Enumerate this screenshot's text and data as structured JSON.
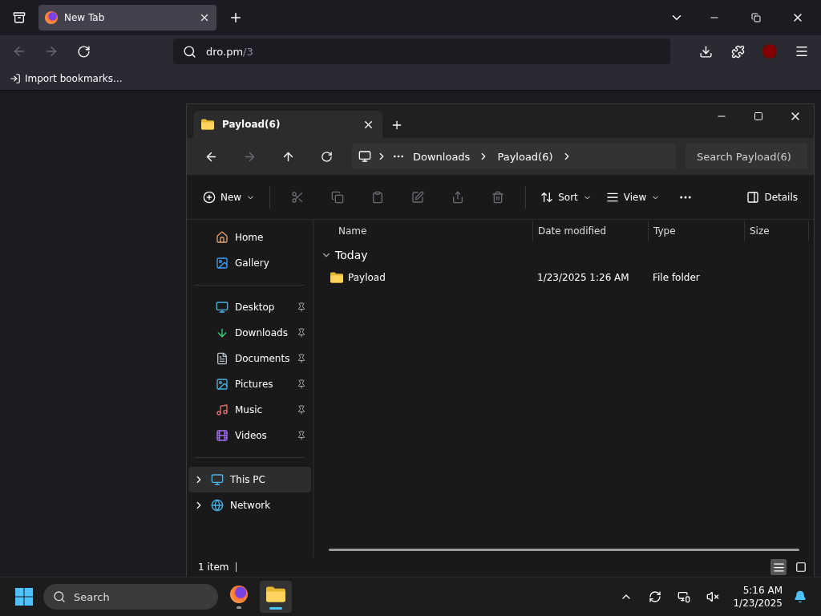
{
  "browser": {
    "tabs": [
      {
        "title": "New Tab",
        "selected": true
      }
    ],
    "address": {
      "host": "dro.pm",
      "path": "/3"
    },
    "bookmarks": [
      {
        "label": "Import bookmarks..."
      }
    ]
  },
  "explorer": {
    "tabs": [
      {
        "title": "Payload(6)",
        "selected": true
      }
    ],
    "breadcrumb": [
      {
        "label": "Downloads"
      },
      {
        "label": "Payload(6)"
      }
    ],
    "search": {
      "placeholder": "Search Payload(6)"
    },
    "toolbar": {
      "new": "New",
      "sort": "Sort",
      "view": "View",
      "details": "Details"
    },
    "sidebar": {
      "quick": [
        {
          "label": "Home",
          "pinned": false
        },
        {
          "label": "Gallery",
          "pinned": false
        }
      ],
      "pinned": [
        {
          "label": "Desktop",
          "pinned": true
        },
        {
          "label": "Downloads",
          "pinned": true
        },
        {
          "label": "Documents",
          "pinned": true
        },
        {
          "label": "Pictures",
          "pinned": true
        },
        {
          "label": "Music",
          "pinned": true
        },
        {
          "label": "Videos",
          "pinned": true
        }
      ],
      "tree": [
        {
          "label": "This PC",
          "expanded": false,
          "selected": true
        },
        {
          "label": "Network",
          "expanded": false,
          "selected": false
        }
      ]
    },
    "columns": [
      "Name",
      "Date modified",
      "Type",
      "Size"
    ],
    "groups": [
      {
        "label": "Today",
        "expanded": true,
        "rows": [
          {
            "name": "Payload",
            "date": "1/23/2025 1:26 AM",
            "type": "File folder"
          }
        ]
      }
    ],
    "status": "1 item",
    "views": [
      {
        "kind": "details",
        "selected": true
      },
      {
        "kind": "tiles",
        "selected": false
      }
    ]
  },
  "taskbar": {
    "search": "Search",
    "apps": [
      {
        "kind": "firefox",
        "active": false
      },
      {
        "kind": "explorer",
        "active": true
      }
    ],
    "time": "5:16 AM",
    "date": "1/23/2025"
  }
}
